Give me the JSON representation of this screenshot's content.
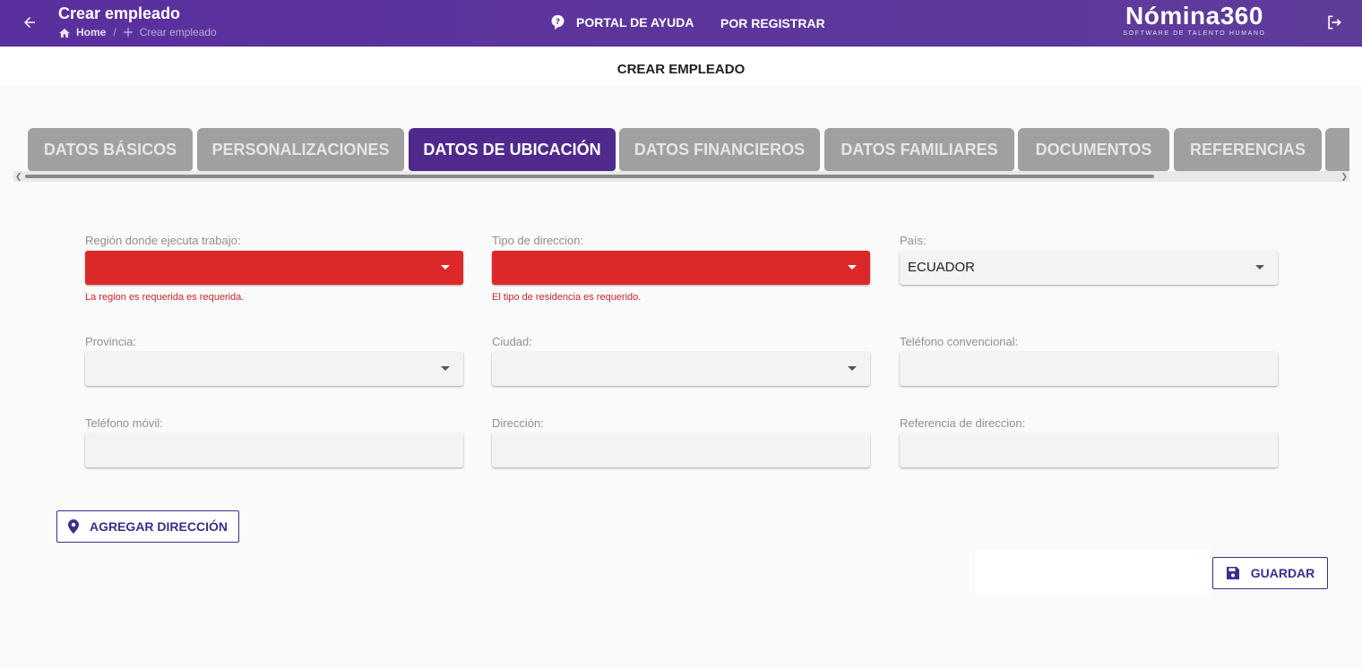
{
  "header": {
    "title": "Crear empleado",
    "breadcrumb": {
      "home": "Home",
      "current": "Crear empleado"
    },
    "help_label": "PORTAL DE AYUDA",
    "register_label": "POR REGISTRAR",
    "logo_name": "Nómina360",
    "logo_tagline": "SOFTWARE DE TALENTO HUMANO"
  },
  "subheader": {
    "title": "CREAR EMPLEADO"
  },
  "tabs": [
    {
      "label": "DATOS BÁSICOS",
      "active": false
    },
    {
      "label": "PERSONALIZACIONES",
      "active": false
    },
    {
      "label": "DATOS DE UBICACIÓN",
      "active": true
    },
    {
      "label": "DATOS FINANCIEROS",
      "active": false
    },
    {
      "label": "DATOS FAMILIARES",
      "active": false
    },
    {
      "label": "DOCUMENTOS",
      "active": false
    },
    {
      "label": "REFERENCIAS",
      "active": false
    }
  ],
  "form": {
    "region": {
      "label": "Región donde ejecuta trabajo:",
      "value": "",
      "error": "La region es requerida es requerida."
    },
    "tipo_direccion": {
      "label": "Tipo de direccion:",
      "value": "",
      "error": "El tipo de residencia es requerido."
    },
    "pais": {
      "label": "País:",
      "value": "ECUADOR"
    },
    "provincia": {
      "label": "Provincia:",
      "value": ""
    },
    "ciudad": {
      "label": "Ciudad:",
      "value": ""
    },
    "telefono_convencional": {
      "label": "Teléfono convencional:",
      "value": ""
    },
    "telefono_movil": {
      "label": "Teléfono móvil:",
      "value": ""
    },
    "direccion": {
      "label": "Dirección:",
      "value": ""
    },
    "referencia_direccion": {
      "label": "Referencia de direccion:",
      "value": ""
    }
  },
  "actions": {
    "add_address_label": "AGREGAR DIRECCIÓN",
    "save_label": "GUARDAR"
  },
  "colors": {
    "header_bg": "#5a2f9e",
    "active_tab": "#4f2a8c",
    "inactive_tab": "#a0a0a0",
    "error": "#dc2828",
    "button_text": "#3d2d8c"
  }
}
